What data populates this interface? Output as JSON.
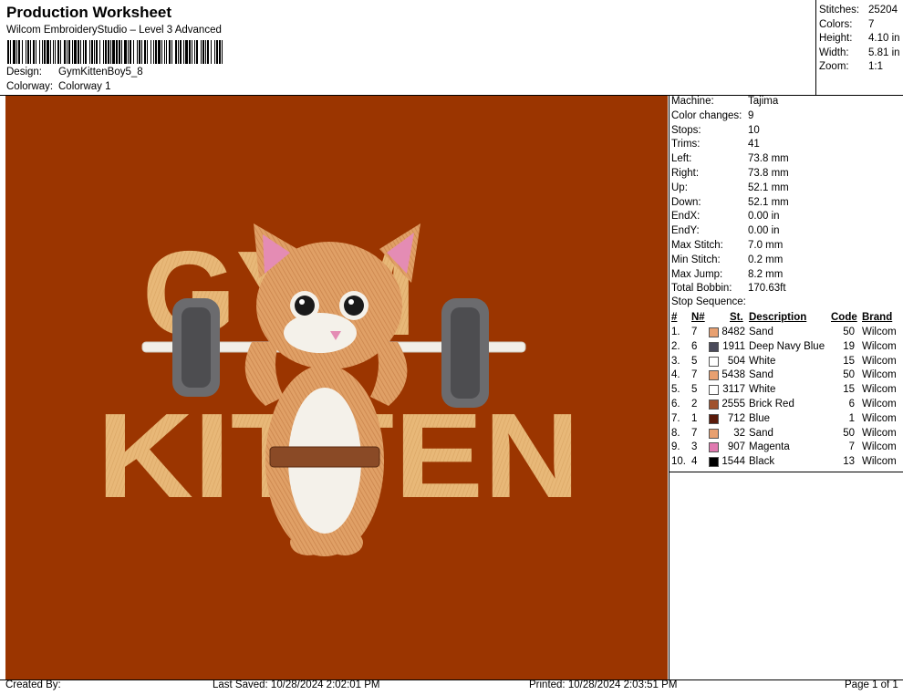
{
  "header": {
    "title": "Production Worksheet",
    "subtitle": "Wilcom EmbroideryStudio – Level 3 Advanced",
    "design_label": "Design:",
    "design_value": "GymKittenBoy5_8",
    "colorway_label": "Colorway:",
    "colorway_value": "Colorway 1"
  },
  "summary": [
    {
      "label": "Stitches:",
      "value": "25204"
    },
    {
      "label": "Colors:",
      "value": "7"
    },
    {
      "label": "Height:",
      "value": "4.10 in"
    },
    {
      "label": "Width:",
      "value": "5.81 in"
    },
    {
      "label": "Zoom:",
      "value": "1:1"
    }
  ],
  "specs": [
    {
      "label": "Machine:",
      "value": "Tajima"
    },
    {
      "label": "Color changes:",
      "value": "9"
    },
    {
      "label": "Stops:",
      "value": "10"
    },
    {
      "label": "Trims:",
      "value": "41"
    },
    {
      "label": "Left:",
      "value": "73.8 mm"
    },
    {
      "label": "Right:",
      "value": "73.8 mm"
    },
    {
      "label": "Up:",
      "value": "52.1 mm"
    },
    {
      "label": "Down:",
      "value": "52.1 mm"
    },
    {
      "label": "EndX:",
      "value": "0.00 in"
    },
    {
      "label": "EndY:",
      "value": "0.00 in"
    },
    {
      "label": "Max Stitch:",
      "value": "7.0 mm"
    },
    {
      "label": "Min Stitch:",
      "value": "0.2 mm"
    },
    {
      "label": "Max Jump:",
      "value": "8.2 mm"
    },
    {
      "label": "Total Bobbin:",
      "value": "170.63ft"
    }
  ],
  "stop_sequence": {
    "title": "Stop Sequence:",
    "headers": {
      "num": "#",
      "n": "N#",
      "st": "St.",
      "desc": "Description",
      "code": "Code",
      "brand": "Brand"
    },
    "rows": [
      {
        "num": "1.",
        "n": "7",
        "color": "#e8a070",
        "st": "8482",
        "desc": "Sand",
        "code": "50",
        "brand": "Wilcom"
      },
      {
        "num": "2.",
        "n": "6",
        "color": "#4a4a5a",
        "st": "1911",
        "desc": "Deep Navy Blue",
        "code": "19",
        "brand": "Wilcom"
      },
      {
        "num": "3.",
        "n": "5",
        "color": "#ffffff",
        "st": "504",
        "desc": "White",
        "code": "15",
        "brand": "Wilcom"
      },
      {
        "num": "4.",
        "n": "7",
        "color": "#e8a070",
        "st": "5438",
        "desc": "Sand",
        "code": "50",
        "brand": "Wilcom"
      },
      {
        "num": "5.",
        "n": "5",
        "color": "#ffffff",
        "st": "3117",
        "desc": "White",
        "code": "15",
        "brand": "Wilcom"
      },
      {
        "num": "6.",
        "n": "2",
        "color": "#a0522d",
        "st": "2555",
        "desc": "Brick Red",
        "code": "6",
        "brand": "Wilcom"
      },
      {
        "num": "7.",
        "n": "1",
        "color": "#5a1a0a",
        "st": "712",
        "desc": "Blue",
        "code": "1",
        "brand": "Wilcom"
      },
      {
        "num": "8.",
        "n": "7",
        "color": "#e8a070",
        "st": "32",
        "desc": "Sand",
        "code": "50",
        "brand": "Wilcom"
      },
      {
        "num": "9.",
        "n": "3",
        "color": "#e07ab0",
        "st": "907",
        "desc": "Magenta",
        "code": "7",
        "brand": "Wilcom"
      },
      {
        "num": "10.",
        "n": "4",
        "color": "#000000",
        "st": "1544",
        "desc": "Black",
        "code": "13",
        "brand": "Wilcom"
      }
    ]
  },
  "design": {
    "background_color": "#9b3500",
    "text_line1": "GYM",
    "text_line2": "KITTEN"
  },
  "footer": {
    "created_by": "Created By:",
    "last_saved": "Last Saved: 10/28/2024 2:02:01 PM",
    "printed": "Printed: 10/28/2024 2:03:51 PM",
    "page": "Page 1 of 1"
  }
}
